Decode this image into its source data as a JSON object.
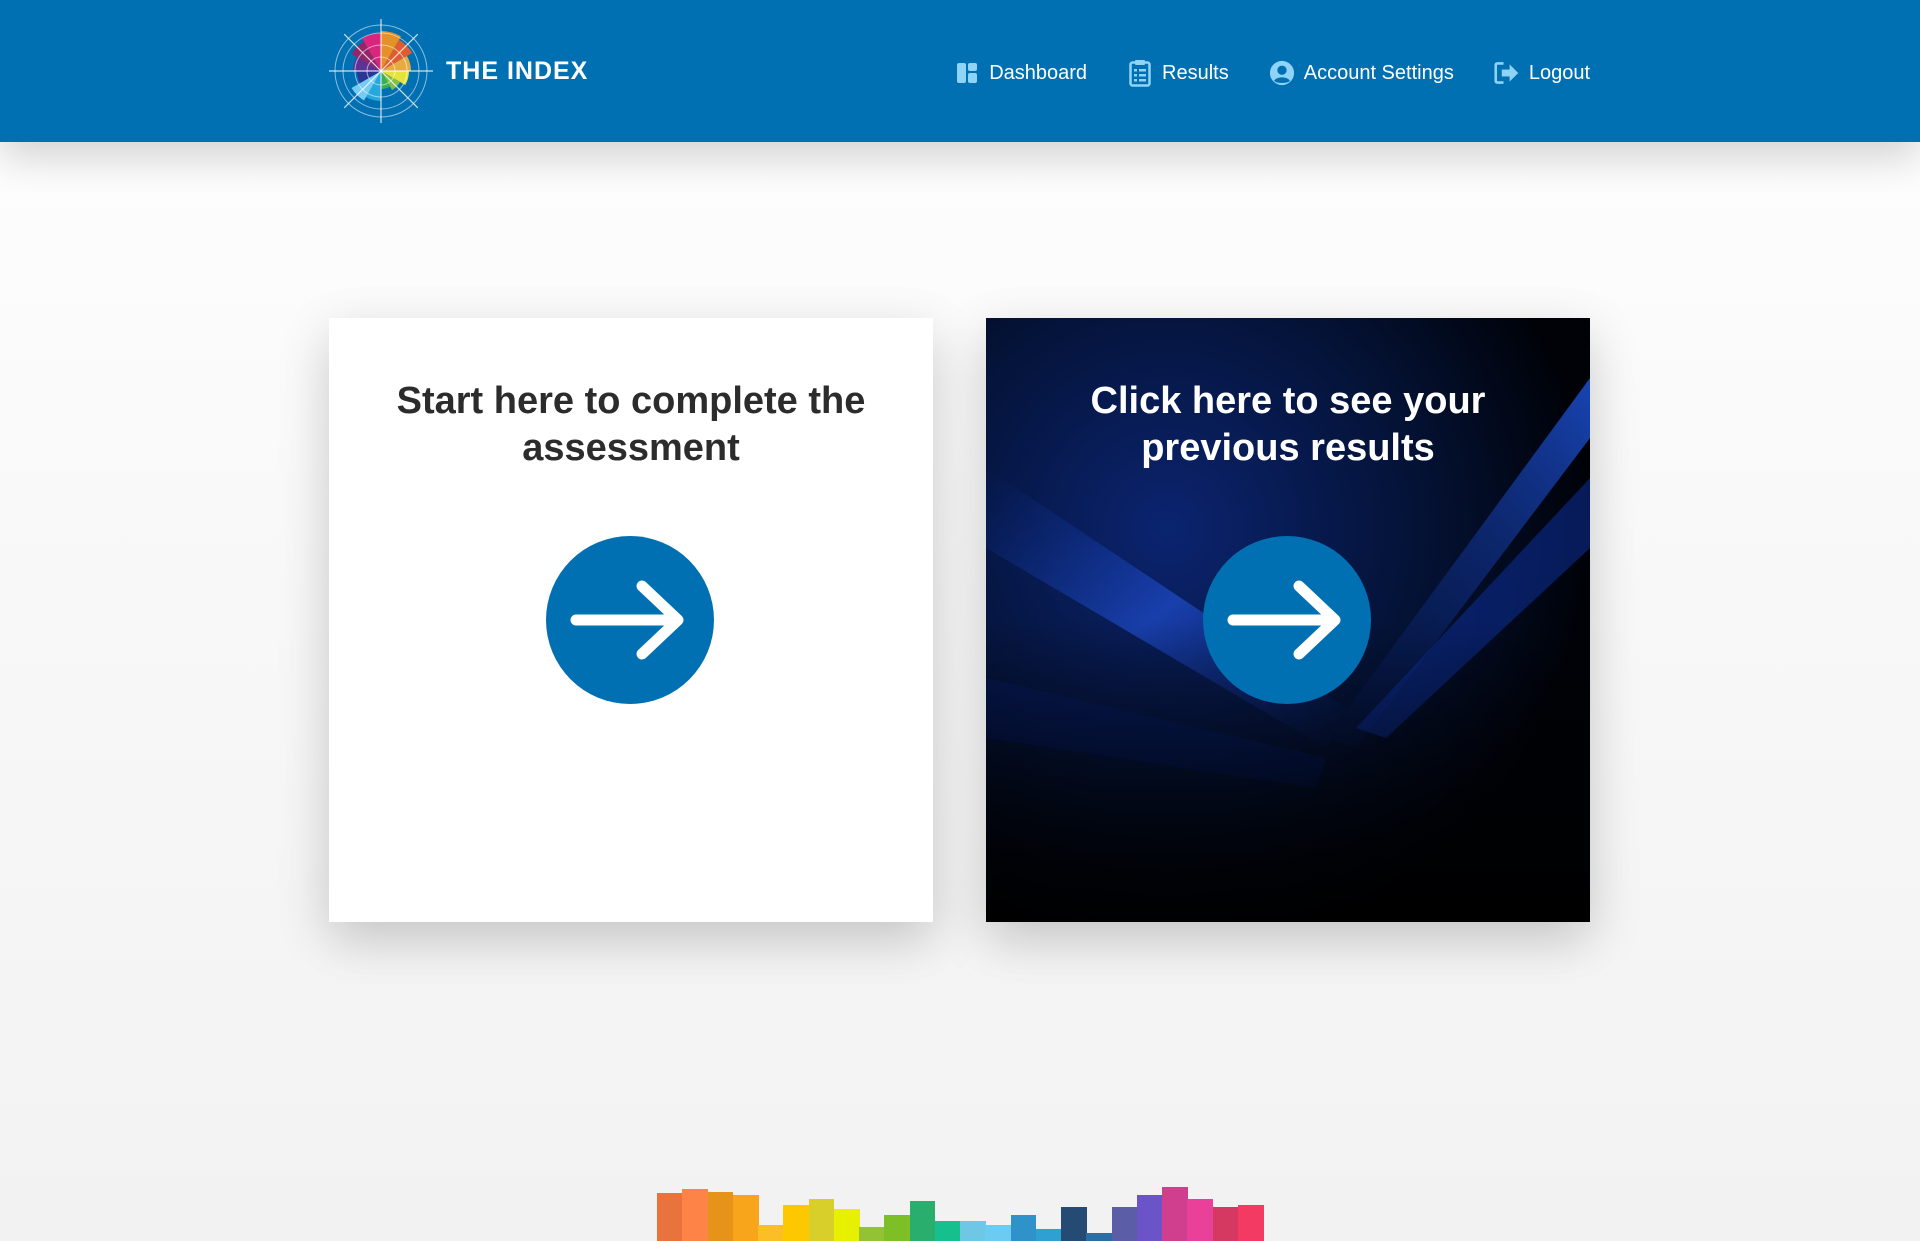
{
  "header": {
    "brand_name": "THE INDEX",
    "brand_color": "#0070b3"
  },
  "nav": [
    {
      "label": "Dashboard",
      "icon": "dashboard-icon"
    },
    {
      "label": "Results",
      "icon": "clipboard-icon"
    },
    {
      "label": "Account Settings",
      "icon": "user-circle-icon"
    },
    {
      "label": "Logout",
      "icon": "logout-icon"
    }
  ],
  "cards": {
    "assessment": {
      "title": "Start here to complete the assessment",
      "icon": "arrow-right-icon"
    },
    "results": {
      "title": "Click here to see your previous results",
      "icon": "arrow-right-icon"
    }
  },
  "footer": {
    "decorative_bar_colors": [
      "#e8733c",
      "#fd8446",
      "#e6931a",
      "#f9a51c",
      "#fbbf25",
      "#fdc800",
      "#d9cf2a",
      "#e7f000",
      "#93c334",
      "#7ebf28",
      "#2aae6e",
      "#16c08e",
      "#6fc7e6",
      "#6bcbf0",
      "#2f92c8",
      "#2fa0d2",
      "#254a74",
      "#2b6ea4",
      "#5b5ea6",
      "#6a54c8",
      "#d03f8e",
      "#e9409a",
      "#d53962",
      "#f23a63"
    ]
  }
}
